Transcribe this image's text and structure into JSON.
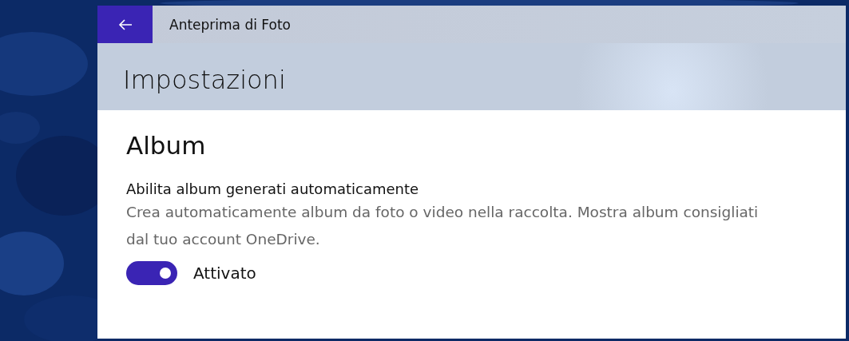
{
  "window": {
    "title": "Anteprima di Foto"
  },
  "header": {
    "title": "Impostazioni"
  },
  "sections": [
    {
      "title": "Album",
      "settings": [
        {
          "kind": "toggle",
          "label": "Abilita album generati automaticamente",
          "description": "Crea automaticamente album da foto o video nella raccolta. Mostra album consigliati dal tuo account OneDrive.",
          "on": true,
          "state_label": "Attivato"
        }
      ]
    }
  ]
}
